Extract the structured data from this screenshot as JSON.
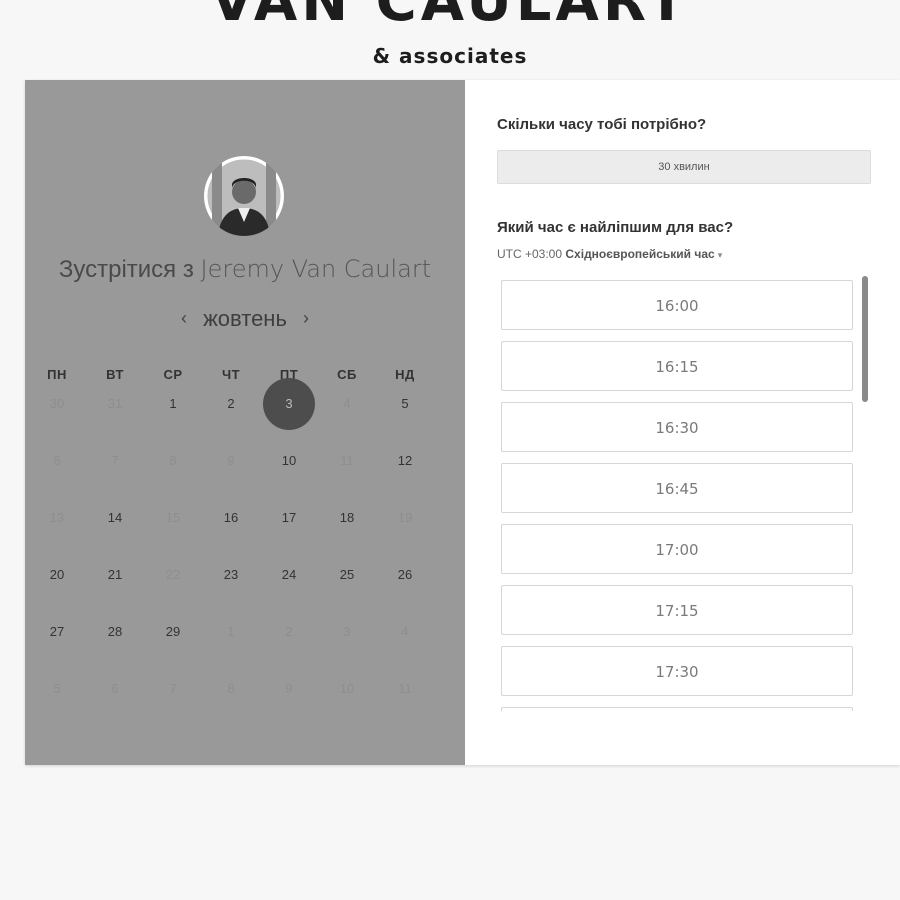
{
  "brand": {
    "title": "VAN CAULART",
    "subtitle": "& associates"
  },
  "left": {
    "meet_prefix": "Зустрітися з ",
    "meet_name": "Jeremy Van Caulart",
    "month": "жовтень",
    "prev_icon": "chevron-left-icon",
    "next_icon": "chevron-right-icon",
    "prev_glyph": "‹",
    "next_glyph": "›",
    "weekdays": [
      "ПН",
      "ВТ",
      "СР",
      "ЧТ",
      "ПТ",
      "СБ",
      "НД"
    ],
    "weeks": [
      [
        {
          "d": "30",
          "m": true
        },
        {
          "d": "31",
          "m": true
        },
        {
          "d": "1"
        },
        {
          "d": "2"
        },
        {
          "d": "3",
          "sel": true
        },
        {
          "d": "4",
          "m": true
        },
        {
          "d": "5"
        }
      ],
      [
        {
          "d": "6",
          "m": true
        },
        {
          "d": "7",
          "m": true
        },
        {
          "d": "8",
          "m": true
        },
        {
          "d": "9",
          "m": true
        },
        {
          "d": "10"
        },
        {
          "d": "11",
          "m": true
        },
        {
          "d": "12"
        }
      ],
      [
        {
          "d": "13",
          "m": true
        },
        {
          "d": "14"
        },
        {
          "d": "15",
          "m": true
        },
        {
          "d": "16"
        },
        {
          "d": "17"
        },
        {
          "d": "18"
        },
        {
          "d": "19",
          "m": true
        }
      ],
      [
        {
          "d": "20"
        },
        {
          "d": "21"
        },
        {
          "d": "22",
          "m": true
        },
        {
          "d": "23"
        },
        {
          "d": "24"
        },
        {
          "d": "25"
        },
        {
          "d": "26"
        }
      ],
      [
        {
          "d": "27"
        },
        {
          "d": "28"
        },
        {
          "d": "29"
        },
        {
          "d": "1",
          "m": true
        },
        {
          "d": "2",
          "m": true
        },
        {
          "d": "3",
          "m": true
        },
        {
          "d": "4",
          "m": true
        }
      ],
      [
        {
          "d": "5",
          "m": true
        },
        {
          "d": "6",
          "m": true
        },
        {
          "d": "7",
          "m": true
        },
        {
          "d": "8",
          "m": true
        },
        {
          "d": "9",
          "m": true
        },
        {
          "d": "10",
          "m": true
        },
        {
          "d": "11",
          "m": true
        }
      ]
    ]
  },
  "right": {
    "duration_question": "Скільки часу тобі потрібно?",
    "duration_value": "30 хвилин",
    "time_question": "Який час є найліпшим для вас?",
    "tz_offset": "UTC +03:00",
    "tz_name": "Східноєвропейський час",
    "tz_caret": "▾",
    "slots": [
      "16:00",
      "16:15",
      "16:30",
      "16:45",
      "17:00",
      "17:15",
      "17:30",
      ""
    ]
  },
  "colors": {
    "left_panel_bg": "#999999",
    "selected_day_bg": "#4d4d4d",
    "page_bg": "#f7f7f7"
  }
}
